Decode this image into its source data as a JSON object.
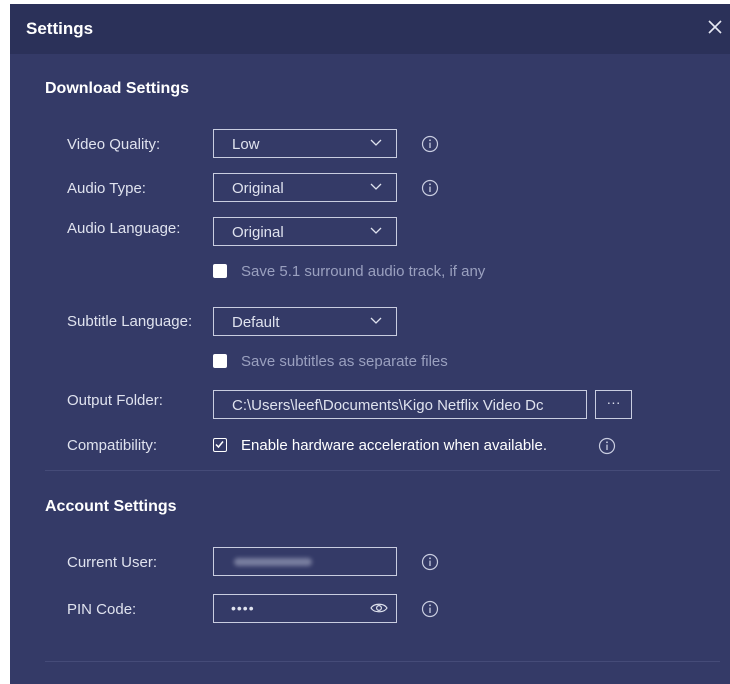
{
  "dialog": {
    "title": "Settings"
  },
  "download": {
    "heading": "Download Settings",
    "video_quality": {
      "label": "Video Quality:",
      "value": "Low"
    },
    "audio_type": {
      "label": "Audio Type:",
      "value": "Original"
    },
    "audio_language": {
      "label": "Audio Language:",
      "value": "Original"
    },
    "surround_check": {
      "label": "Save 5.1 surround audio track, if any",
      "checked": false
    },
    "subtitle_language": {
      "label": "Subtitle Language:",
      "value": "Default"
    },
    "subtitles_check": {
      "label": "Save subtitles as separate files",
      "checked": false
    },
    "output_folder": {
      "label": "Output Folder:",
      "value": "C:\\Users\\leef\\Documents\\Kigo Netflix Video Dc",
      "browse": "···"
    },
    "compatibility": {
      "label": "Compatibility:",
      "option": "Enable hardware acceleration when available.",
      "checked": true
    }
  },
  "account": {
    "heading": "Account Settings",
    "current_user": {
      "label": "Current User:"
    },
    "pin_code": {
      "label": "PIN Code:",
      "value": "••••"
    }
  },
  "icons": {
    "close": "close-icon",
    "info": "info-icon",
    "chevron": "chevron-down-icon",
    "eye": "eye-icon"
  },
  "colors": {
    "background": "#343a67",
    "titlebar": "#2b3159",
    "border": "#c9cde0"
  }
}
